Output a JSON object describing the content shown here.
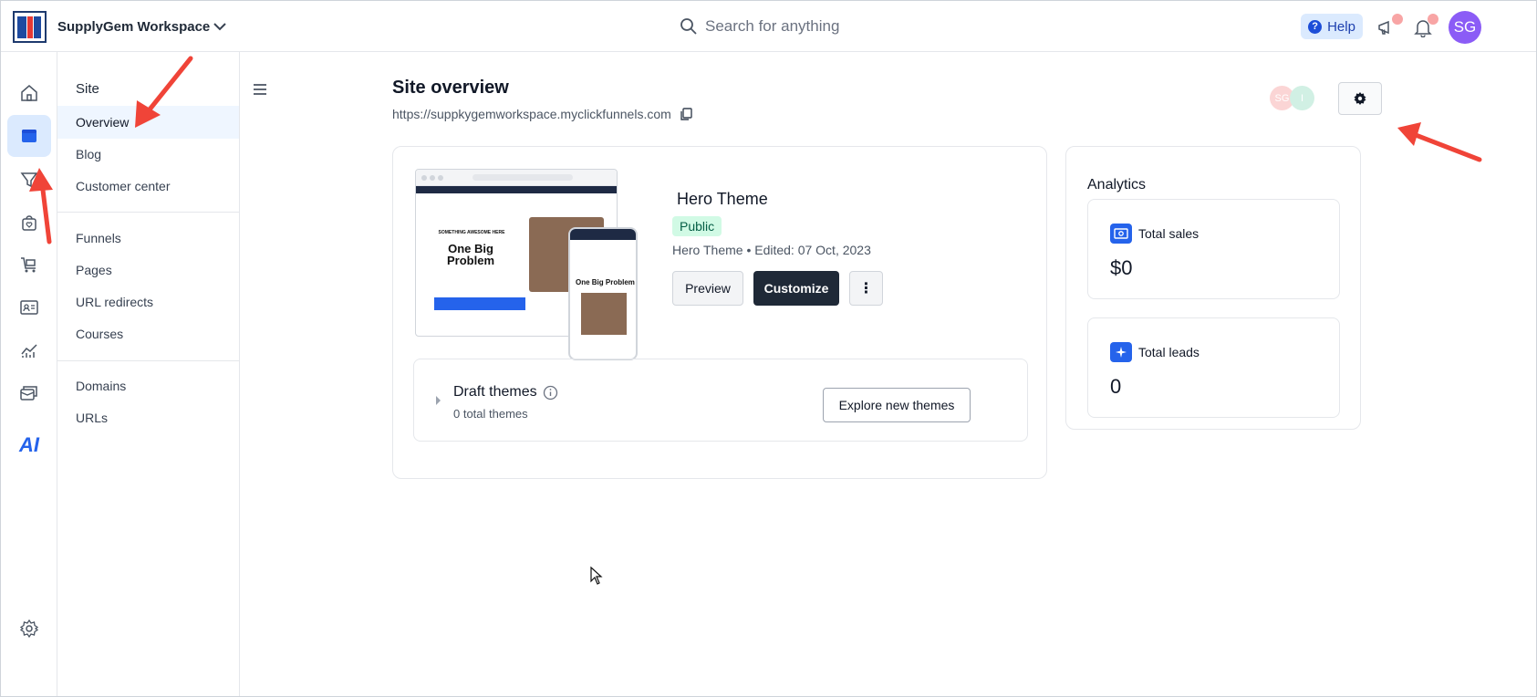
{
  "topbar": {
    "workspace": "SupplyGem Workspace",
    "search_placeholder": "Search for anything",
    "help_label": "Help",
    "avatar_initials": "SG"
  },
  "rail": {
    "items": [
      "home-icon",
      "site-icon",
      "funnel-icon",
      "store-icon",
      "cart-icon",
      "contacts-icon",
      "analytics-icon",
      "workflow-icon",
      "ai-icon",
      "settings-icon"
    ],
    "ai_label": "AI"
  },
  "subnav": {
    "site_heading": "Site",
    "group1": [
      "Overview",
      "Blog",
      "Customer center"
    ],
    "group2": [
      "Funnels",
      "Pages",
      "URL redirects",
      "Courses"
    ],
    "group3": [
      "Domains",
      "URLs"
    ]
  },
  "main": {
    "title": "Site overview",
    "url": "https://suppkygemworkspace.myclickfunnels.com",
    "collaborators": [
      "SG",
      "I"
    ],
    "theme": {
      "name": "Hero Theme",
      "status": "Public",
      "meta": "Hero Theme • Edited: 07 Oct, 2023",
      "preview_label": "Preview",
      "customize_label": "Customize",
      "more_label": "⋮",
      "thumb_headline": "One Big Problem",
      "thumb_kicker": "SOMETHING AWESOME HERE"
    },
    "draft": {
      "title": "Draft themes",
      "subtitle": "0 total themes",
      "explore_label": "Explore new themes"
    },
    "analytics": {
      "title": "Analytics",
      "sales_label": "Total sales",
      "sales_value": "$0",
      "leads_label": "Total leads",
      "leads_value": "0"
    }
  },
  "colors": {
    "accent": "#2563eb",
    "dark_button": "#1f2937",
    "annotation_arrow": "#f04438",
    "avatar": "#8b5cf6"
  }
}
